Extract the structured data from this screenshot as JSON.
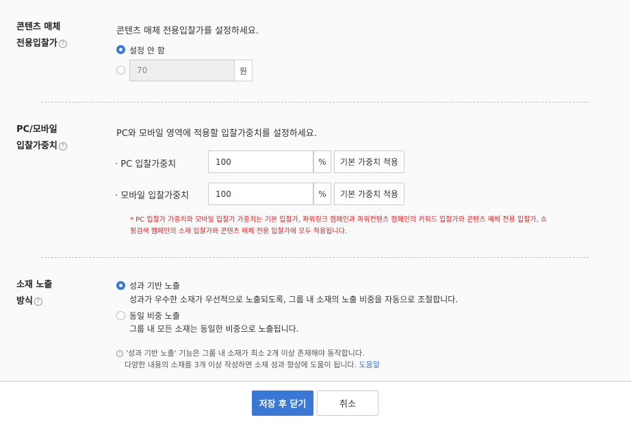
{
  "section_media": {
    "label_line1": "콘텐츠 매체",
    "label_line2": "전용입찰가",
    "description": "콘텐츠 매체 전용입찰가를 설정하세요.",
    "option_none": "설정 안 함",
    "bid_value": "70",
    "bid_unit": "원"
  },
  "section_weight": {
    "label_line1": "PC/모바일",
    "label_line2": "입찰가중치",
    "description": "PC와 모바일 영역에 적용할 입찰가중치를 설정하세요.",
    "pc": {
      "label": "· PC 입찰가중치",
      "value": "100",
      "unit": "%",
      "button": "기본 가중치 적용"
    },
    "mobile": {
      "label": "· 모바일 입찰가중치",
      "value": "100",
      "unit": "%",
      "button": "기본 가중치 적용"
    },
    "notice_line1": "* PC 입찰가 가중치와 모바일 입찰가 가중치는 기본 입찰가, 파워링크 캠페인과 파워컨텐츠 캠페인의 키워드 입찰가와 콘텐츠 매체 전용 입찰가, 쇼",
    "notice_line2": "핑검색 캠페인의 소재 입찰가와 콘텐츠 매체 전용 입찰가에 모두 적용됩니다."
  },
  "section_exposure": {
    "label_line1": "소재 노출",
    "label_line2": "방식",
    "option_performance": "성과 기반 노출",
    "option_performance_desc": "성과가 우수한 소재가 우선적으로 노출되도록, 그룹 내 소재의 노출 비중을 자동으로 조절합니다.",
    "option_equal": "동일 비중 노출",
    "option_equal_desc": "그룹 내 모든 소재는 동일한 비중으로 노출됩니다.",
    "info_line1": "'성과 기반 노출' 기능은 그룹 내 소재가 최소 2개 이상 존재해야 동작합니다.",
    "info_line2": "다양한 내용의 소재를 3개 이상 작성하면 소재 성과 향상에 도움이 됩니다.",
    "help_link": "도움말"
  },
  "footer": {
    "save_close": "저장 후 닫기",
    "cancel": "취소"
  },
  "colors": {
    "accent": "#3a78d4",
    "notice": "#e02020"
  }
}
